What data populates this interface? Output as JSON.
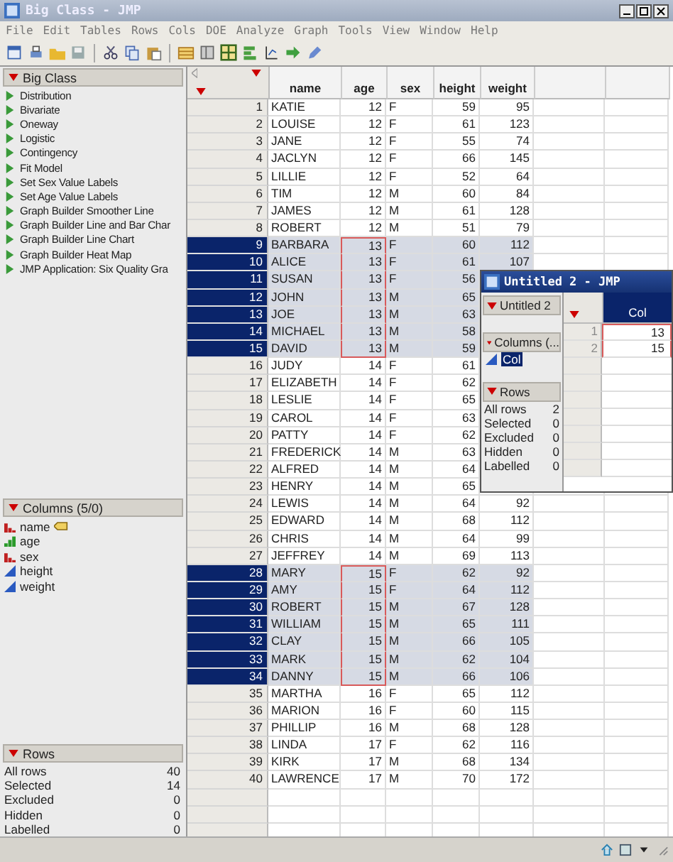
{
  "window": {
    "title": "Big Class - JMP"
  },
  "menu": [
    "File",
    "Edit",
    "Tables",
    "Rows",
    "Cols",
    "DOE",
    "Analyze",
    "Graph",
    "Tools",
    "View",
    "Window",
    "Help"
  ],
  "table_panel": {
    "title": "Big Class",
    "scripts": [
      "Distribution",
      "Bivariate",
      "Oneway",
      "Logistic",
      "Contingency",
      "Fit Model",
      "Set Sex Value Labels",
      "Set Age Value Labels",
      "Graph Builder Smoother Line",
      "Graph Builder Line and Bar Char",
      "Graph Builder Line Chart",
      "Graph Builder Heat Map",
      "JMP Application: Six Quality Gra"
    ]
  },
  "columns_panel": {
    "title": "Columns (5/0)",
    "columns": [
      {
        "name": "name",
        "kind": "nominal",
        "label": true
      },
      {
        "name": "age",
        "kind": "ordinal",
        "label": false
      },
      {
        "name": "sex",
        "kind": "nominal",
        "label": false
      },
      {
        "name": "height",
        "kind": "continuous",
        "label": false
      },
      {
        "name": "weight",
        "kind": "continuous",
        "label": false
      }
    ]
  },
  "rows_panel": {
    "title": "Rows",
    "stats": [
      {
        "label": "All rows",
        "value": "40"
      },
      {
        "label": "Selected",
        "value": "14"
      },
      {
        "label": "Excluded",
        "value": "0"
      },
      {
        "label": "Hidden",
        "value": "0"
      },
      {
        "label": "Labelled",
        "value": "0"
      }
    ]
  },
  "table": {
    "columns": [
      {
        "name": "name",
        "numeric": false
      },
      {
        "name": "age",
        "numeric": true
      },
      {
        "name": "sex",
        "numeric": false
      },
      {
        "name": "height",
        "numeric": true
      },
      {
        "name": "weight",
        "numeric": true
      }
    ],
    "rows": [
      {
        "n": "1",
        "cells": [
          "KATIE",
          "12",
          "F",
          "59",
          "95"
        ],
        "selected": false,
        "boxed": false
      },
      {
        "n": "2",
        "cells": [
          "LOUISE",
          "12",
          "F",
          "61",
          "123"
        ],
        "selected": false,
        "boxed": false
      },
      {
        "n": "3",
        "cells": [
          "JANE",
          "12",
          "F",
          "55",
          "74"
        ],
        "selected": false,
        "boxed": false
      },
      {
        "n": "4",
        "cells": [
          "JACLYN",
          "12",
          "F",
          "66",
          "145"
        ],
        "selected": false,
        "boxed": false
      },
      {
        "n": "5",
        "cells": [
          "LILLIE",
          "12",
          "F",
          "52",
          "64"
        ],
        "selected": false,
        "boxed": false
      },
      {
        "n": "6",
        "cells": [
          "TIM",
          "12",
          "M",
          "60",
          "84"
        ],
        "selected": false,
        "boxed": false
      },
      {
        "n": "7",
        "cells": [
          "JAMES",
          "12",
          "M",
          "61",
          "128"
        ],
        "selected": false,
        "boxed": false
      },
      {
        "n": "8",
        "cells": [
          "ROBERT",
          "12",
          "M",
          "51",
          "79"
        ],
        "selected": false,
        "boxed": false
      },
      {
        "n": "9",
        "cells": [
          "BARBARA",
          "13",
          "F",
          "60",
          "112"
        ],
        "selected": true,
        "boxed": true
      },
      {
        "n": "10",
        "cells": [
          "ALICE",
          "13",
          "F",
          "61",
          "107"
        ],
        "selected": true,
        "boxed": true
      },
      {
        "n": "11",
        "cells": [
          "SUSAN",
          "13",
          "F",
          "56"
        ],
        "selected": true,
        "boxed": true
      },
      {
        "n": "12",
        "cells": [
          "JOHN",
          "13",
          "M",
          "65"
        ],
        "selected": true,
        "boxed": true
      },
      {
        "n": "13",
        "cells": [
          "JOE",
          "13",
          "M",
          "63"
        ],
        "selected": true,
        "boxed": true
      },
      {
        "n": "14",
        "cells": [
          "MICHAEL",
          "13",
          "M",
          "58"
        ],
        "selected": true,
        "boxed": true
      },
      {
        "n": "15",
        "cells": [
          "DAVID",
          "13",
          "M",
          "59"
        ],
        "selected": true,
        "boxed": true
      },
      {
        "n": "16",
        "cells": [
          "JUDY",
          "14",
          "F",
          "61"
        ],
        "selected": false,
        "boxed": false
      },
      {
        "n": "17",
        "cells": [
          "ELIZABETH",
          "14",
          "F",
          "62"
        ],
        "selected": false,
        "boxed": false
      },
      {
        "n": "18",
        "cells": [
          "LESLIE",
          "14",
          "F",
          "65"
        ],
        "selected": false,
        "boxed": false
      },
      {
        "n": "19",
        "cells": [
          "CAROL",
          "14",
          "F",
          "63"
        ],
        "selected": false,
        "boxed": false
      },
      {
        "n": "20",
        "cells": [
          "PATTY",
          "14",
          "F",
          "62"
        ],
        "selected": false,
        "boxed": false
      },
      {
        "n": "21",
        "cells": [
          "FREDERICK",
          "14",
          "M",
          "63"
        ],
        "selected": false,
        "boxed": false
      },
      {
        "n": "22",
        "cells": [
          "ALFRED",
          "14",
          "M",
          "64"
        ],
        "selected": false,
        "boxed": false
      },
      {
        "n": "23",
        "cells": [
          "HENRY",
          "14",
          "M",
          "65"
        ],
        "selected": false,
        "boxed": false
      },
      {
        "n": "24",
        "cells": [
          "LEWIS",
          "14",
          "M",
          "64",
          "92"
        ],
        "selected": false,
        "boxed": false
      },
      {
        "n": "25",
        "cells": [
          "EDWARD",
          "14",
          "M",
          "68",
          "112"
        ],
        "selected": false,
        "boxed": false
      },
      {
        "n": "26",
        "cells": [
          "CHRIS",
          "14",
          "M",
          "64",
          "99"
        ],
        "selected": false,
        "boxed": false
      },
      {
        "n": "27",
        "cells": [
          "JEFFREY",
          "14",
          "M",
          "69",
          "113"
        ],
        "selected": false,
        "boxed": false
      },
      {
        "n": "28",
        "cells": [
          "MARY",
          "15",
          "F",
          "62",
          "92"
        ],
        "selected": true,
        "boxed": true
      },
      {
        "n": "29",
        "cells": [
          "AMY",
          "15",
          "F",
          "64",
          "112"
        ],
        "selected": true,
        "boxed": true
      },
      {
        "n": "30",
        "cells": [
          "ROBERT",
          "15",
          "M",
          "67",
          "128"
        ],
        "selected": true,
        "boxed": true
      },
      {
        "n": "31",
        "cells": [
          "WILLIAM",
          "15",
          "M",
          "65",
          "111"
        ],
        "selected": true,
        "boxed": true
      },
      {
        "n": "32",
        "cells": [
          "CLAY",
          "15",
          "M",
          "66",
          "105"
        ],
        "selected": true,
        "boxed": true
      },
      {
        "n": "33",
        "cells": [
          "MARK",
          "15",
          "M",
          "62",
          "104"
        ],
        "selected": true,
        "boxed": true
      },
      {
        "n": "34",
        "cells": [
          "DANNY",
          "15",
          "M",
          "66",
          "106"
        ],
        "selected": true,
        "boxed": true
      },
      {
        "n": "35",
        "cells": [
          "MARTHA",
          "16",
          "F",
          "65",
          "112"
        ],
        "selected": false,
        "boxed": false
      },
      {
        "n": "36",
        "cells": [
          "MARION",
          "16",
          "F",
          "60",
          "115"
        ],
        "selected": false,
        "boxed": false
      },
      {
        "n": "37",
        "cells": [
          "PHILLIP",
          "16",
          "M",
          "68",
          "128"
        ],
        "selected": false,
        "boxed": false
      },
      {
        "n": "38",
        "cells": [
          "LINDA",
          "17",
          "F",
          "62",
          "116"
        ],
        "selected": false,
        "boxed": false
      },
      {
        "n": "39",
        "cells": [
          "KIRK",
          "17",
          "M",
          "68",
          "134"
        ],
        "selected": false,
        "boxed": false
      },
      {
        "n": "40",
        "cells": [
          "LAWRENCE",
          "17",
          "M",
          "70",
          "172"
        ],
        "selected": false,
        "boxed": false
      }
    ]
  },
  "popup_window": {
    "title": "Untitled 2 - JMP",
    "table_panel_title": "Untitled 2",
    "columns_title": "Columns (...",
    "columns": [
      {
        "name": "Col",
        "kind": "continuous",
        "selected": true
      }
    ],
    "rows_title": "Rows",
    "stats": [
      {
        "label": "All rows",
        "value": "2"
      },
      {
        "label": "Selected",
        "value": "0"
      },
      {
        "label": "Excluded",
        "value": "0"
      },
      {
        "label": "Hidden",
        "value": "0"
      },
      {
        "label": "Labelled",
        "value": "0"
      }
    ],
    "table": {
      "columns": [
        {
          "name": "Col",
          "selected": true
        }
      ],
      "rows": [
        {
          "n": "1",
          "cells": [
            "13"
          ],
          "boxed": true
        },
        {
          "n": "2",
          "cells": [
            "15"
          ],
          "boxed": true
        }
      ]
    }
  }
}
